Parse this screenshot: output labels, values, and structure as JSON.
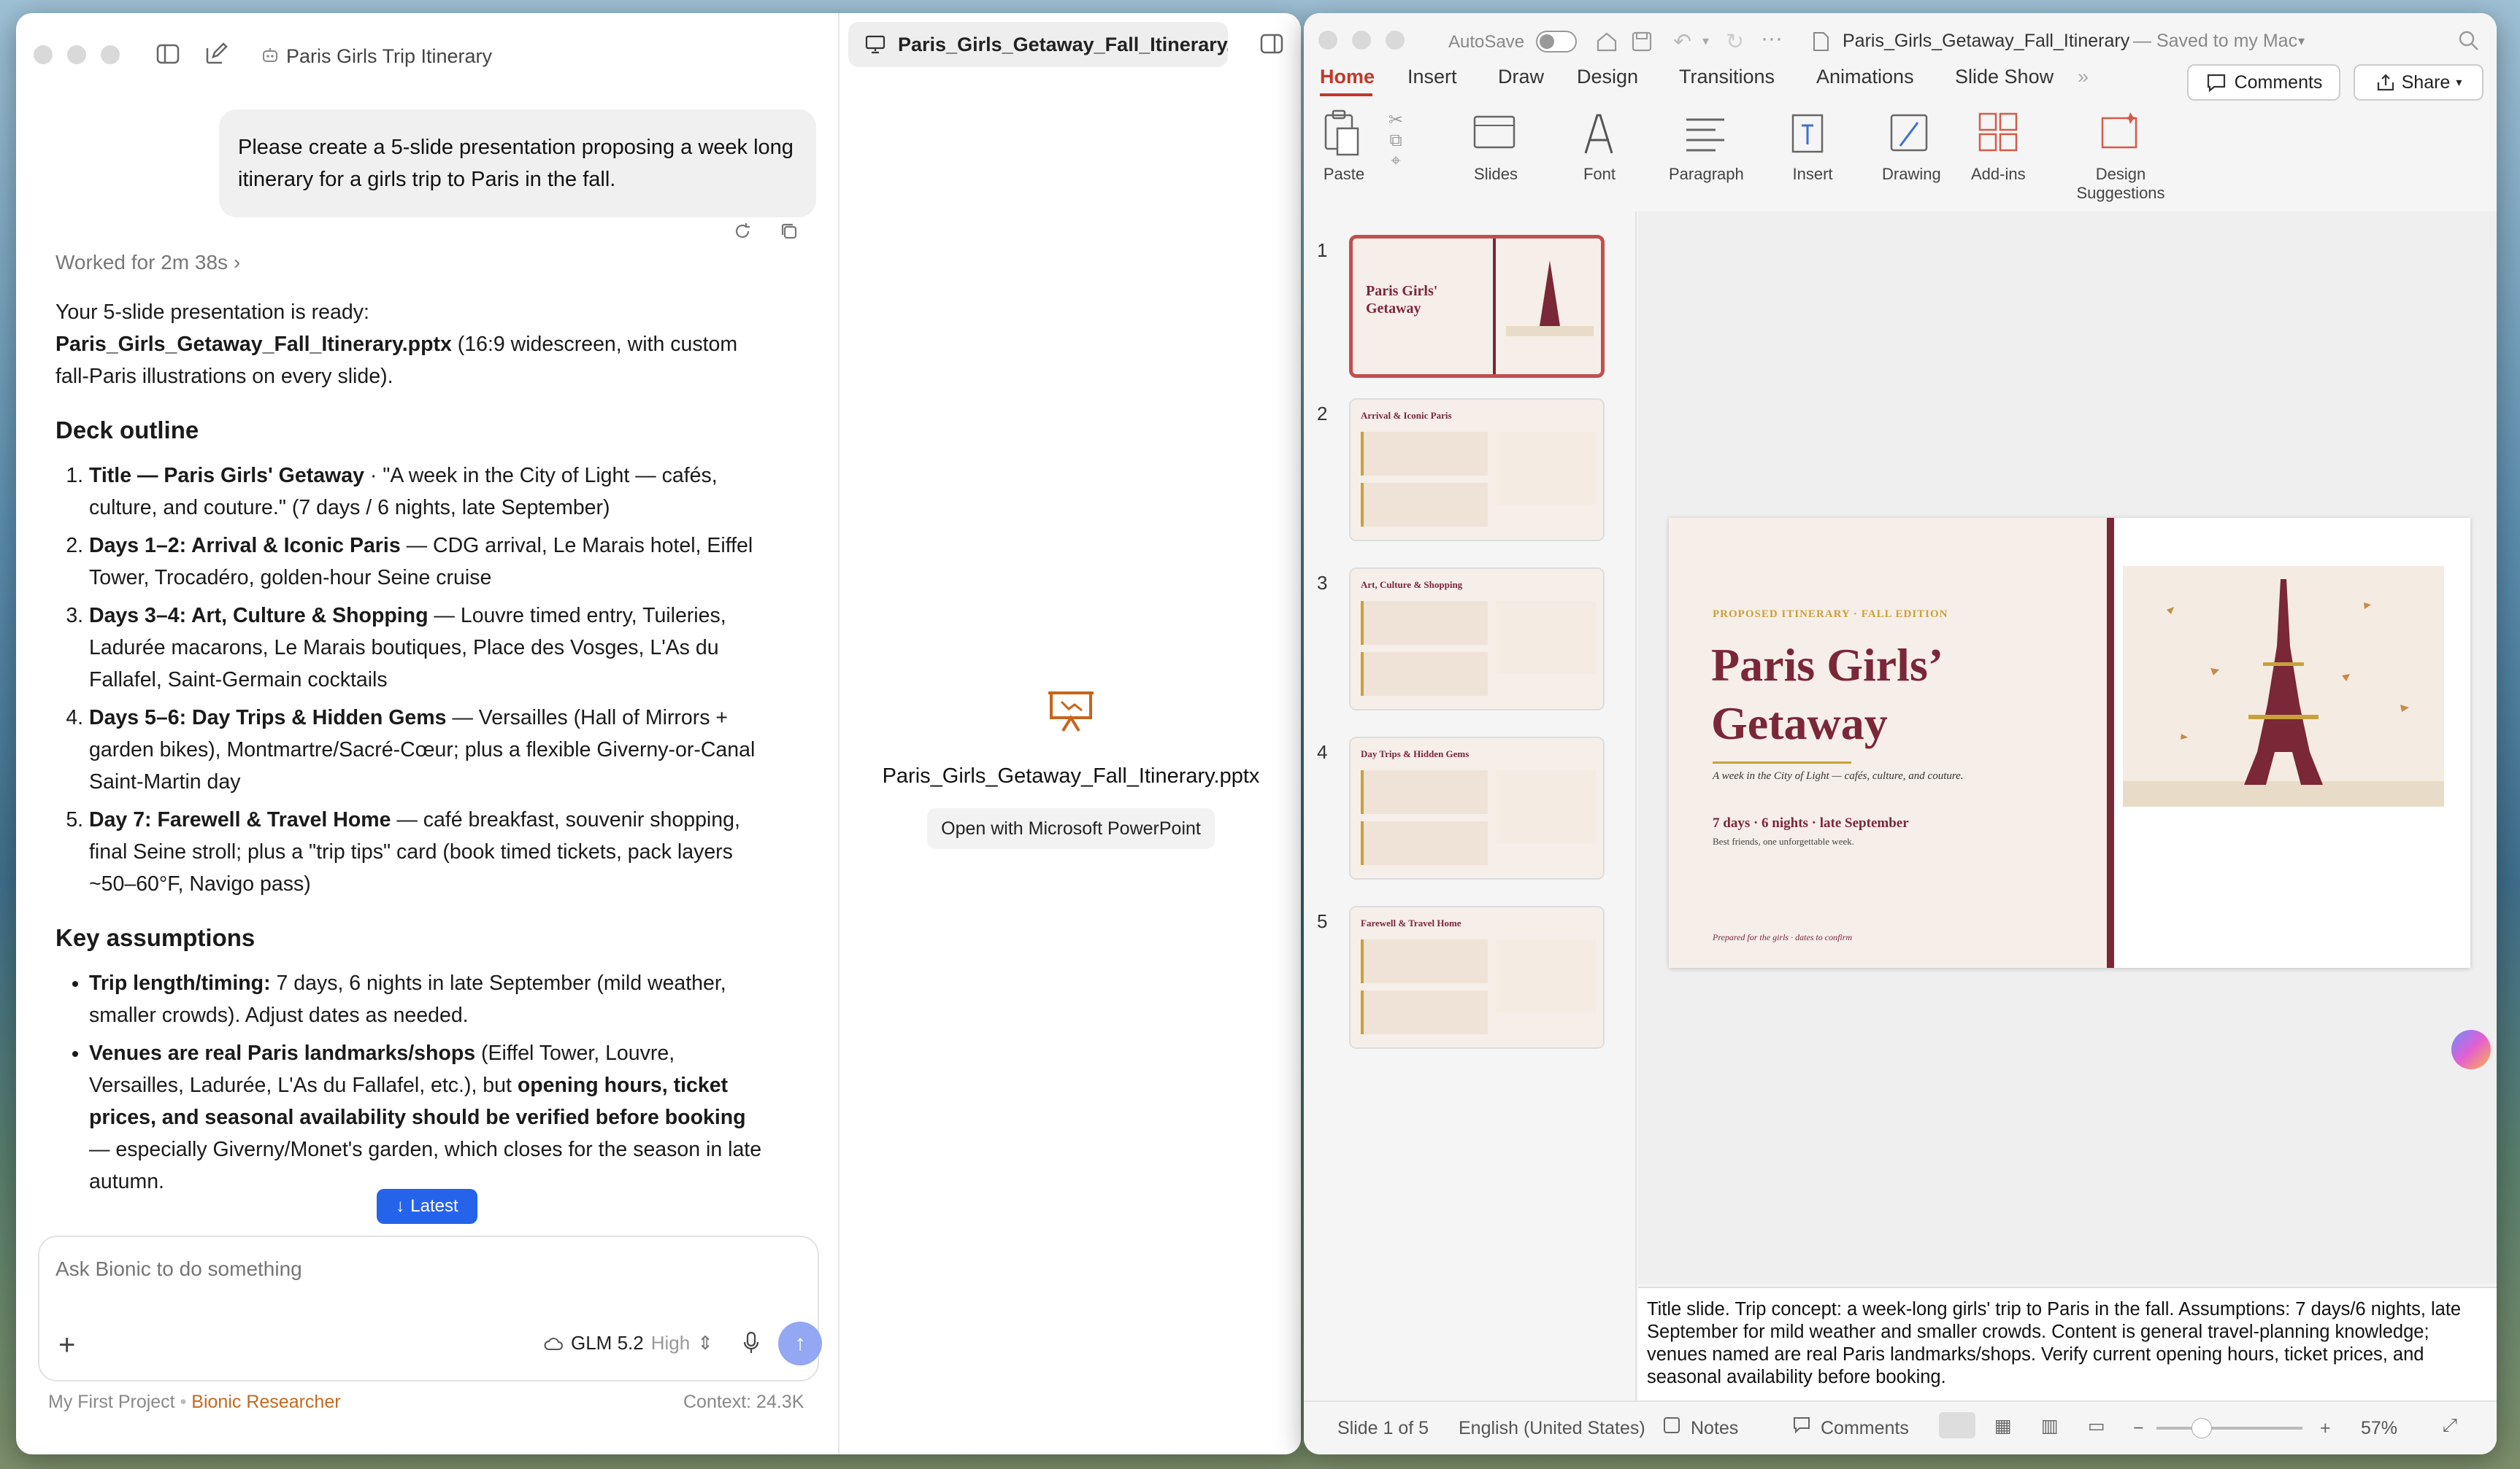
{
  "chat": {
    "window_title": "Paris Girls Trip Itinerary",
    "user_message": "Please create a 5-slide presentation proposing a week long itinerary for a girls trip to Paris in the fall.",
    "worked_for": "Worked for 2m 38s",
    "intro_line": "Your 5-slide presentation is ready:",
    "intro_file": "Paris_Girls_Getaway_Fall_Itinerary.pptx",
    "intro_rest": " (16:9 widescreen, with custom fall-Paris illustrations on every slide).",
    "outline_heading": "Deck outline",
    "outline": [
      {
        "bold": "Title — Paris Girls' Getaway",
        "text": " · \"A week in the City of Light — cafés, culture, and couture.\" (7 days / 6 nights, late September)"
      },
      {
        "bold": "Days 1–2: Arrival & Iconic Paris",
        "text": " — CDG arrival, Le Marais hotel, Eiffel Tower, Trocadéro, golden-hour Seine cruise"
      },
      {
        "bold": "Days 3–4: Art, Culture & Shopping",
        "text": " — Louvre timed entry, Tuileries, Ladurée macarons, Le Marais boutiques, Place des Vosges, L'As du Fallafel, Saint-Germain cocktails"
      },
      {
        "bold": "Days 5–6: Day Trips & Hidden Gems",
        "text": " — Versailles (Hall of Mirrors + garden bikes), Montmartre/Sacré-Cœur; plus a flexible Giverny-or-Canal Saint-Martin day"
      },
      {
        "bold": "Day 7: Farewell & Travel Home",
        "text": " — café breakfast, souvenir shopping, final Seine stroll; plus a \"trip tips\" card (book timed tickets, pack layers ~50–60°F, Navigo pass)"
      }
    ],
    "assumptions_heading": "Key assumptions",
    "assumption1_bold": "Trip length/timing:",
    "assumption1_text": " 7 days, 6 nights in late September (mild weather, smaller crowds). Adjust dates as needed.",
    "assumption2_bold1": "Venues are real Paris landmarks/shops",
    "assumption2_text1": " (Eiffel Tower, Louvre, Versailles, Ladurée, L'As du Fallafel, etc.), but ",
    "assumption2_bold2": "opening hours, ticket prices, and seasonal availability should be verified before booking",
    "assumption2_text2": " — especially Giverny/Monet's garden, which closes for the season in late autumn.",
    "latest_label": "Latest",
    "input_placeholder": "Ask Bionic to do something",
    "model_name": "GLM 5.2",
    "model_level": "High",
    "project": "My First Project",
    "agent": "Bionic Researcher",
    "context": "Context: 24.3K"
  },
  "viewer": {
    "tab_label": "Paris_Girls_Getaway_Fall_Itinerary...",
    "file_name": "Paris_Girls_Getaway_Fall_Itinerary.pptx",
    "open_button": "Open with Microsoft PowerPoint"
  },
  "ppt": {
    "autosave": "AutoSave",
    "doc_title": "Paris_Girls_Getaway_Fall_Itinerary",
    "saved": "— Saved to my Mac",
    "tabs": [
      "Home",
      "Insert",
      "Draw",
      "Design",
      "Transitions",
      "Animations",
      "Slide Show"
    ],
    "comments_btn": "Comments",
    "share_btn": "Share",
    "groups": [
      "Paste",
      "Slides",
      "Font",
      "Paragraph",
      "Insert",
      "Drawing",
      "Add-ins",
      "Design Suggestions"
    ],
    "thumb_numbers": [
      "1",
      "2",
      "3",
      "4",
      "5"
    ],
    "thumb_titles": [
      "Paris Girls' Getaway",
      "Arrival & Iconic Paris",
      "Art, Culture & Shopping",
      "Day Trips & Hidden Gems",
      "Farewell & Travel Home"
    ],
    "slide": {
      "kicker": "PROPOSED ITINERARY  ·  FALL EDITION",
      "title1": "Paris Girls’",
      "title2": "Getaway",
      "subtitle": "A week in the City of Light — cafés, culture, and couture.",
      "stats": "7 days  ·  6 nights  ·  late September",
      "tagline": "Best friends, one unforgettable week.",
      "footer": "Prepared for the girls  ·  dates to confirm"
    },
    "notes": "Title slide. Trip concept: a week-long girls' trip to Paris in the fall. Assumptions: 7 days/6 nights, late September for mild weather and smaller crowds. Content is general travel-planning knowledge; venues named are real Paris landmarks/shops. Verify current opening hours, ticket prices, and seasonal availability before booking.",
    "status_slide": "Slide 1 of 5",
    "status_lang": "English (United States)",
    "status_notes": "Notes",
    "status_comments": "Comments",
    "zoom": "57%"
  },
  "colors": {
    "accent": "#7a2737",
    "gold": "#c9a13b",
    "slide_bg": "#f6eee8",
    "link": "#2563eb"
  }
}
